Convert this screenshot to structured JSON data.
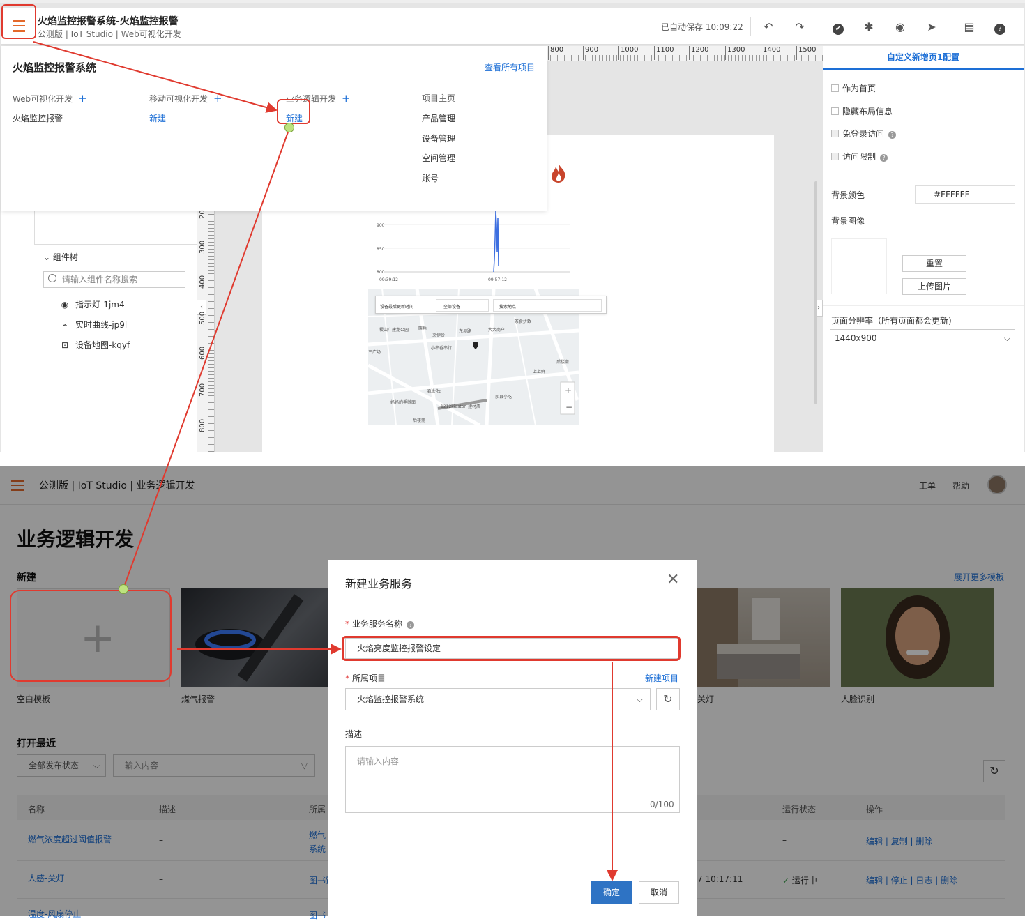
{
  "top": {
    "title": "火焰监控报警系统-火焰监控报警",
    "subtitle": "公测版 | IoT Studio | Web可视化开发",
    "autosave": "已自动保存 10:09:22",
    "dropdown": {
      "project_name": "火焰监控报警系统",
      "view_all": "查看所有项目",
      "columns": [
        {
          "label": "Web可视化开发",
          "item": "火焰监控报警"
        },
        {
          "label": "移动可视化开发",
          "item": "新建"
        },
        {
          "label": "业务逻辑开发",
          "item": "新建"
        },
        {
          "label": "项目主页",
          "items": [
            "产品管理",
            "设备管理",
            "空间管理",
            "账号"
          ]
        }
      ]
    },
    "component_tree": {
      "title": "组件树",
      "search_placeholder": "请输入组件名称搜索",
      "items": [
        {
          "label": "指示灯-1jm4",
          "icon": "indicator-icon"
        },
        {
          "label": "实时曲线-jp9l",
          "icon": "line-chart-icon"
        },
        {
          "label": "设备地图-kqyf",
          "icon": "map-icon"
        }
      ]
    },
    "ruler_h": [
      "800",
      "900",
      "1000",
      "1100",
      "1200",
      "1300",
      "1400",
      "1500"
    ],
    "ruler_v": [
      "20",
      "300",
      "400",
      "500",
      "600",
      "700",
      "800"
    ],
    "chart": {
      "y_ticks": [
        "900",
        "850",
        "800"
      ],
      "x_ticks": [
        "09:39:12",
        "09:57:12"
      ]
    },
    "map": {
      "search1": "设备最后更新时间",
      "search2": "全部设备",
      "search3": "搜索地点",
      "labels": [
        "稷山广建龙公园",
        "晓角",
        "东坝路",
        "大大商户",
        "茶食拼致",
        "来伊份",
        "小串香串行",
        "三广场",
        "上上鲜",
        "后楼斋",
        "酒涂·独",
        "沙县小吃",
        "妈妈的手擀面",
        "上上鲜",
        "1212kidston 建材店",
        "后楼斋"
      ]
    },
    "right_panel": {
      "tab": "自定义新增页1配置",
      "checks": [
        "作为首页",
        "隐藏布局信息",
        "免登录访问",
        "访问限制"
      ],
      "bg_color_label": "背景颜色",
      "bg_color_value": "#FFFFFF",
      "bg_image_label": "背景图像",
      "reset": "重置",
      "upload": "上传图片",
      "resolution_label": "页面分辨率（所有页面都会更新)",
      "resolution_value": "1440x900"
    }
  },
  "bottom": {
    "breadcrumb": "公测版 | IoT Studio | 业务逻辑开发",
    "header_links": [
      "工单",
      "帮助"
    ],
    "page_title": "业务逻辑开发",
    "new_section": "新建",
    "more_templates": "展开更多模板",
    "templates": [
      "空白模板",
      "煤气报警",
      "关灯",
      "人脸识别"
    ],
    "recent_title": "打开最近",
    "filter_status": "全部发布状态",
    "filter_input_placeholder": "输入内容",
    "columns": [
      "名称",
      "描述",
      "所属",
      "运行状态",
      "操作"
    ],
    "rows": [
      {
        "name": "燃气浓度超过阈值报警",
        "desc": "–",
        "project": "燃气 系统",
        "time": "",
        "status": "–",
        "ops": [
          "编辑",
          "复制",
          "删除"
        ]
      },
      {
        "name": "人感-关灯",
        "desc": "–",
        "project": "图书馆",
        "time": "7 10:17:11",
        "status": "运行中",
        "ops": [
          "编辑",
          "停止",
          "日志",
          "删除"
        ]
      },
      {
        "name": "温度-风扇停止",
        "desc": "",
        "project": "图书",
        "time": "",
        "status": "",
        "ops": []
      }
    ]
  },
  "modal": {
    "title": "新建业务服务",
    "name_label": "业务服务名称",
    "name_value": "火焰亮度监控报警设定",
    "project_label": "所属项目",
    "new_project": "新建项目",
    "project_value": "火焰监控报警系统",
    "desc_label": "描述",
    "desc_placeholder": "请输入内容",
    "counter": "0/100",
    "ok": "确定",
    "cancel": "取消"
  },
  "colors": {
    "accent": "#1d6fd6",
    "annotation": "#e03a2f",
    "menu": "#e4692b",
    "ok_button": "#2e73c4"
  }
}
